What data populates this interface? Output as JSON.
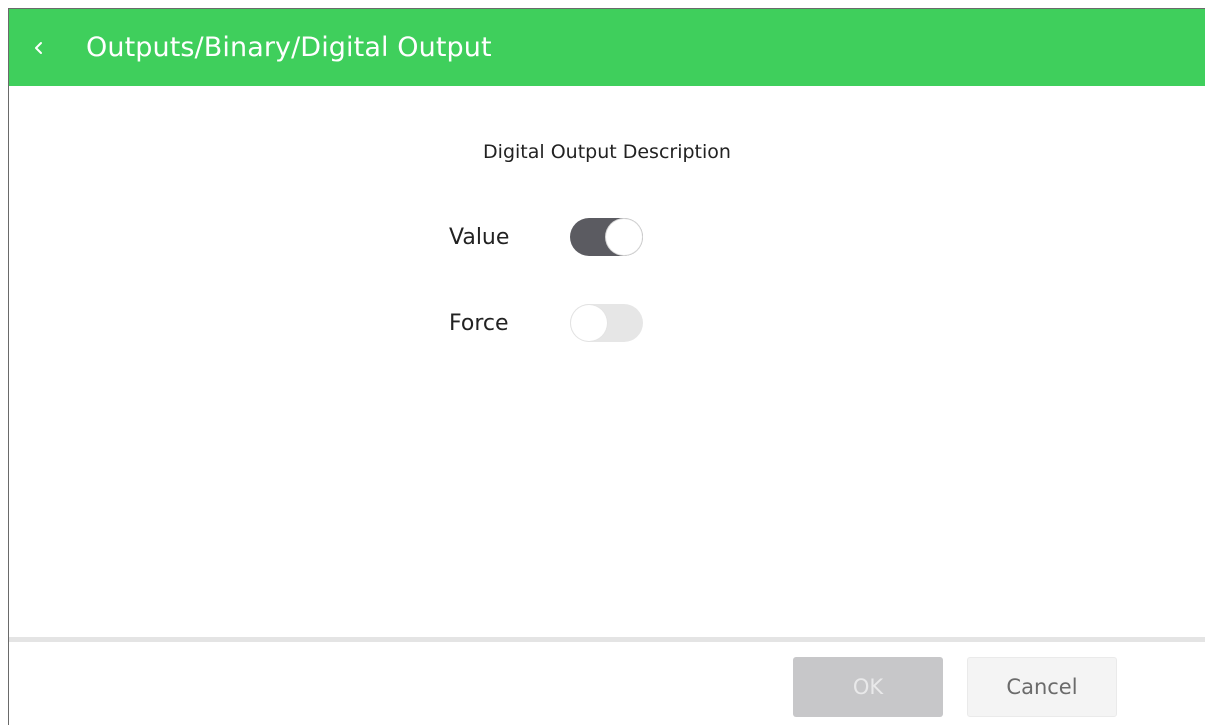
{
  "header": {
    "title": "Outputs/Binary/Digital Output",
    "back_icon": "chevron-left-icon",
    "background_color": "#3fcf5c"
  },
  "main": {
    "description": "Digital Output Description",
    "fields": [
      {
        "label": "Value",
        "state": "on"
      },
      {
        "label": "Force",
        "state": "off"
      }
    ]
  },
  "toggle_colors": {
    "on_track": "#5b5b61",
    "off_track": "#e6e6e6"
  },
  "footer": {
    "ok_label": "OK",
    "ok_enabled": false,
    "cancel_label": "Cancel",
    "ok_background": "#c7c7c9",
    "ok_text_color": "#e9e9ea",
    "cancel_background": "#f4f4f4",
    "cancel_text_color": "#6b6b6b"
  }
}
